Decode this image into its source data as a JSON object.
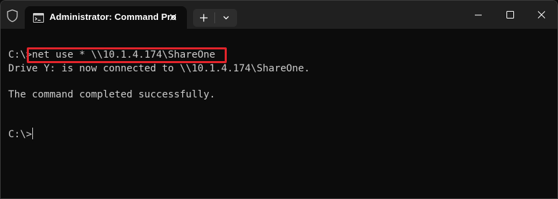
{
  "window": {
    "tab_title": "Administrator: Command Pro",
    "icons": {
      "shield": "shield-icon",
      "cmd": "cmd-icon",
      "close_tab": "close-icon",
      "new_tab": "plus-icon",
      "dropdown": "chevron-down-icon",
      "minimize": "minimize-icon",
      "maximize": "maximize-icon",
      "close_window": "close-icon"
    }
  },
  "terminal": {
    "line1_prompt": "C:\\>",
    "line1_command": "net use * \\\\10.1.4.174\\ShareOne",
    "line2": "Drive Y: is now connected to \\\\10.1.4.174\\ShareOne.",
    "line3": "",
    "line4": "The command completed successfully.",
    "line5": "",
    "line6": "",
    "line7_prompt": "C:\\>"
  },
  "colors": {
    "terminal_bg": "#0c0c0c",
    "titlebar_bg": "#202020",
    "text": "#cccccc",
    "highlight_border": "#e3242b"
  }
}
